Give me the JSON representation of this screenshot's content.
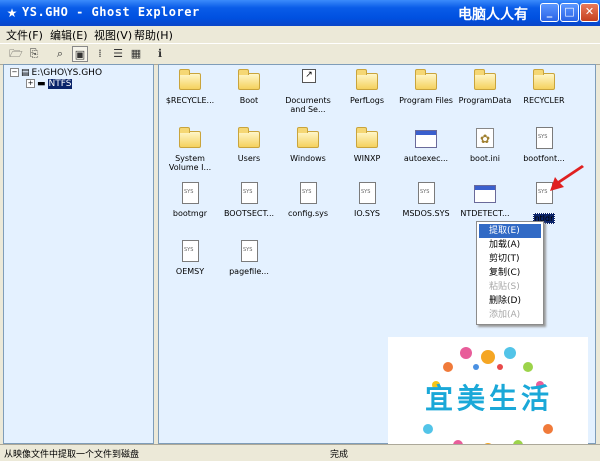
{
  "window": {
    "title": "YS.GHO - Ghost Explorer",
    "watermark": "电脑人人有"
  },
  "menu": [
    "文件(F)",
    "编辑(E)",
    "视图(V)",
    "帮助(H)"
  ],
  "tree": {
    "root": "E:\\GHO\\YS.GHO",
    "child": "NTFS"
  },
  "items": [
    {
      "label": "$RECYCLE...",
      "icon": "folder-icon"
    },
    {
      "label": "Boot",
      "icon": "folder-icon"
    },
    {
      "label": "Documents and Se...",
      "icon": "shortcut-icon"
    },
    {
      "label": "PerfLogs",
      "icon": "folder-icon"
    },
    {
      "label": "Program Files",
      "icon": "folder-icon"
    },
    {
      "label": "ProgramData",
      "icon": "folder-icon"
    },
    {
      "label": "RECYCLER",
      "icon": "folder-icon"
    },
    {
      "label": "System Volume I...",
      "icon": "folder-icon"
    },
    {
      "label": "Users",
      "icon": "folder-icon"
    },
    {
      "label": "Windows",
      "icon": "folder-icon"
    },
    {
      "label": "WINXP",
      "icon": "folder-icon"
    },
    {
      "label": "autoexec...",
      "icon": "window-file-icon"
    },
    {
      "label": "boot.ini",
      "icon": "settings-file-icon"
    },
    {
      "label": "bootfont...",
      "icon": "system-file-icon"
    },
    {
      "label": "bootmgr",
      "icon": "system-file-icon"
    },
    {
      "label": "BOOTSECT...",
      "icon": "system-file-icon"
    },
    {
      "label": "config.sys",
      "icon": "system-file-icon"
    },
    {
      "label": "IO.SYS",
      "icon": "system-file-icon"
    },
    {
      "label": "MSDOS.SYS",
      "icon": "system-file-icon"
    },
    {
      "label": "NTDETECT...",
      "icon": "window-file-icon"
    },
    {
      "label": "ntldr",
      "icon": "system-file-icon"
    },
    {
      "label": "OEMSY",
      "icon": "system-file-icon"
    },
    {
      "label": "pagefile...",
      "icon": "system-file-icon"
    }
  ],
  "context_menu": [
    "提取(E)",
    "加载(A)",
    "剪切(T)",
    "复制(C)",
    "粘贴(S)",
    "删除(D)",
    "添加(A)"
  ],
  "status": {
    "left": "从映像文件中提取一个文件到磁盘",
    "right": "完成"
  },
  "logo": {
    "text": "宜美生活"
  },
  "colors": {
    "title_bar": "#0050e0",
    "pane_bg": "#e4f1ff",
    "selection": "#316ac5",
    "arrow": "#e02020"
  }
}
